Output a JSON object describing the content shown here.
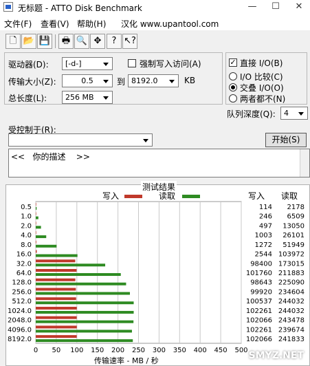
{
  "window": {
    "title": "无标题 - ATTO Disk Benchmark",
    "controls": {
      "minimize": "—",
      "maximize": "☐",
      "close": "✕"
    }
  },
  "menu": {
    "items": [
      "文件(F)",
      "查看(V)",
      "帮助(H)"
    ],
    "ad": "汉化 www.upantool.com"
  },
  "toolbar": {
    "icons": [
      "new-icon",
      "open-icon",
      "save-icon",
      "print-icon",
      "print-preview-icon",
      "move-icon",
      "help-icon",
      "context-help-icon"
    ]
  },
  "form": {
    "drive_label": "驱动器(D):",
    "drive_value": "[-d-]",
    "force_write_label": "强制写入访问(A)",
    "direct_io_label": "直接 I/O(B)",
    "transfer_size_label": "传输大小(Z):",
    "transfer_from": "0.5",
    "to_label": "到",
    "transfer_to": "8192.0",
    "unit": "KB",
    "total_length_label": "总长度(L):",
    "total_length_value": "256 MB",
    "io_compare_label": "I/O 比较(C)",
    "overlap_io_label": "交叠 I/O(O)",
    "neither_label": "两者都不(N)",
    "queue_depth_label": "队列深度(Q):",
    "queue_depth_value": "4",
    "controlled_by_label": "受控制于(R):",
    "start_button": "开始(S)",
    "description": "<<   你的描述    >>"
  },
  "results": {
    "title": "测试结果",
    "legend_write": "写入",
    "legend_read": "读取",
    "col_write": "写入",
    "col_read": "读取",
    "x_axis_label": "传输速率 - MB / 秒",
    "watermark": "SMYZ.NET",
    "colors": {
      "write": "#c0392b",
      "read": "#2e8b22"
    }
  },
  "chart_data": {
    "type": "bar",
    "title": "测试结果",
    "xlabel": "传输速率 - MB / 秒",
    "ylabel": "",
    "xlim": [
      0,
      500
    ],
    "x_ticks": [
      0,
      50,
      100,
      150,
      200,
      250,
      300,
      350,
      400,
      450,
      500
    ],
    "categories": [
      "0.5",
      "1.0",
      "2.0",
      "4.0",
      "8.0",
      "16.0",
      "32.0",
      "64.0",
      "128.0",
      "256.0",
      "512.0",
      "1024.0",
      "2048.0",
      "4096.0",
      "8192.0"
    ],
    "series": [
      {
        "name": "写入",
        "values": [
          114,
          246,
          497,
          1003,
          1272,
          2544,
          98400,
          101760,
          98643,
          99920,
          100537,
          102261,
          102066,
          102261,
          102066
        ]
      },
      {
        "name": "读取",
        "values": [
          2178,
          6509,
          13050,
          26101,
          51949,
          103972,
          173015,
          211883,
          225090,
          234604,
          244032,
          244032,
          243478,
          239674,
          241833
        ]
      }
    ],
    "units": "KB/s",
    "grid": true,
    "legend": "top"
  }
}
